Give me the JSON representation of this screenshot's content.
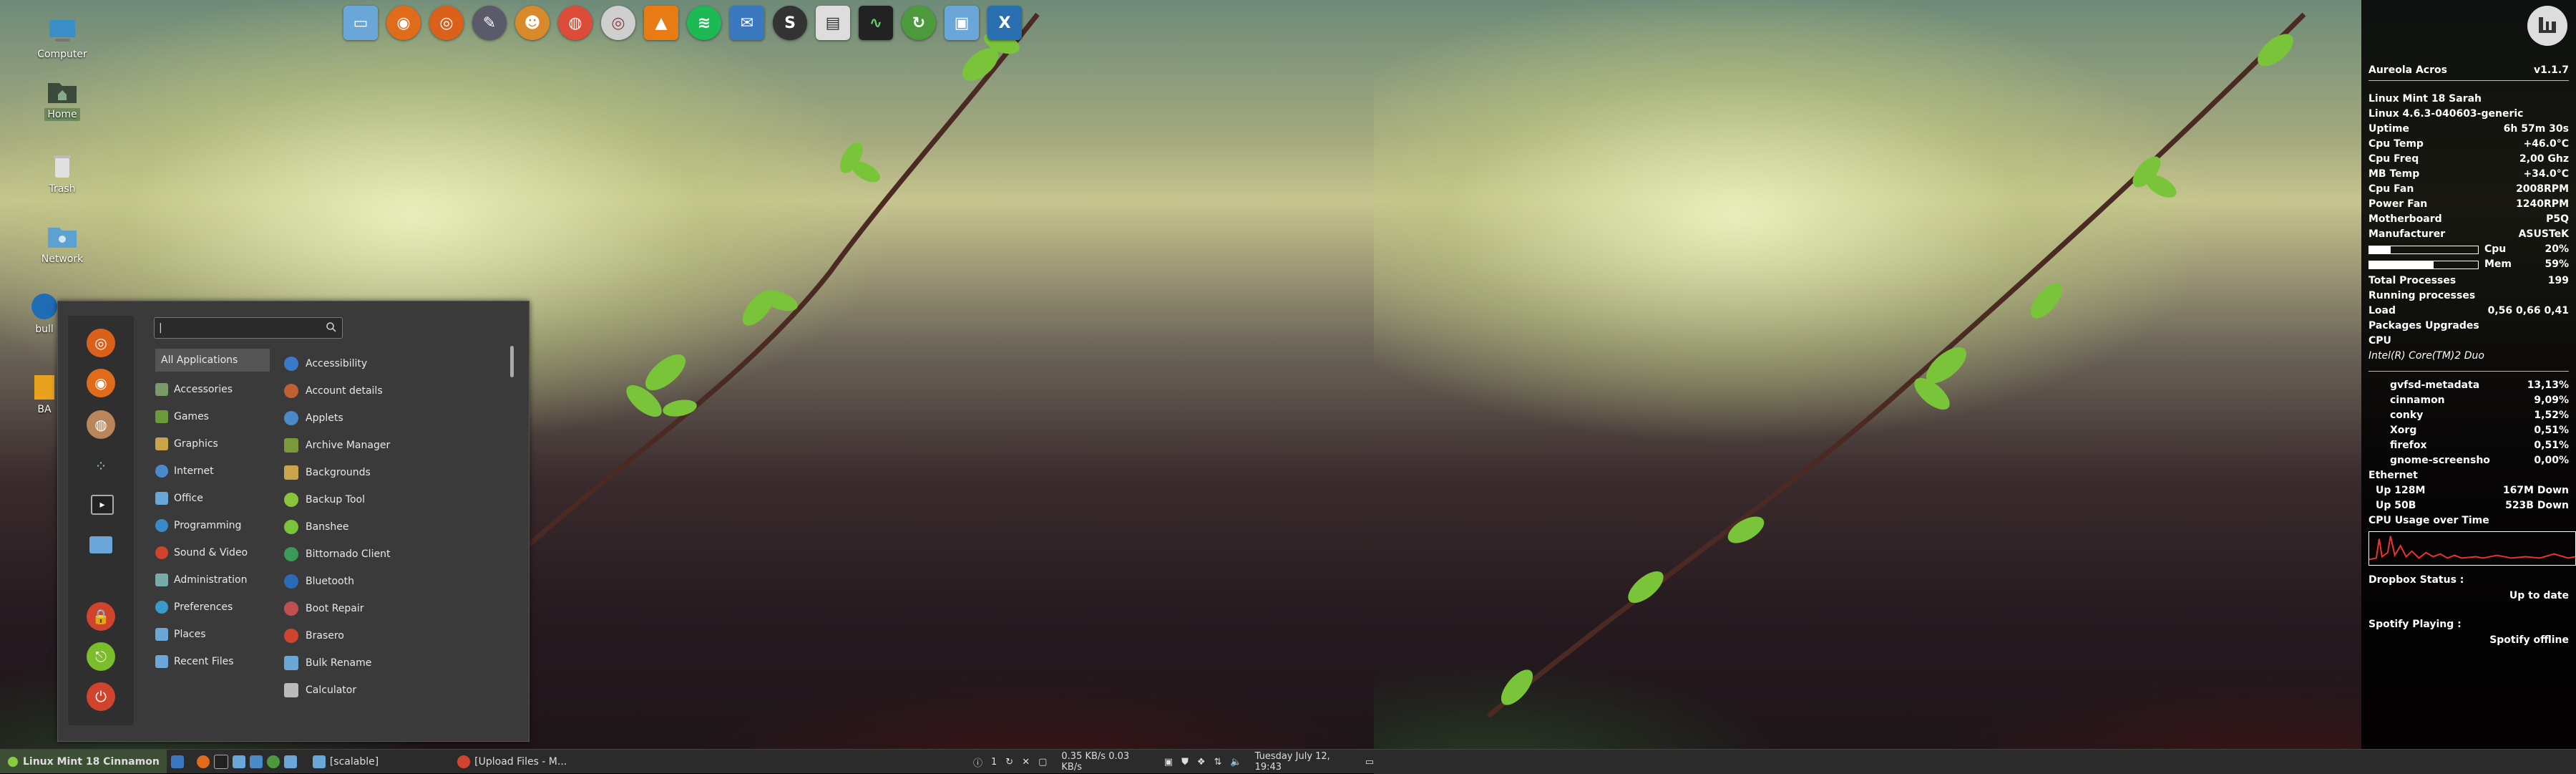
{
  "desktop_icons": [
    {
      "label": "Computer",
      "icon": "computer-icon"
    },
    {
      "label": "Home",
      "icon": "home-folder-icon",
      "selected": true
    },
    {
      "label": "Trash",
      "icon": "trash-icon"
    },
    {
      "label": "Network",
      "icon": "network-icon"
    },
    {
      "label": "bull",
      "icon": "app-icon"
    },
    {
      "label": "BA",
      "icon": "folder-icon"
    }
  ],
  "dock": [
    "files-icon",
    "firefox-icon",
    "browser-icon",
    "inkscape-icon",
    "gimp-icon",
    "chrome-icon",
    "disk-icon",
    "vlc-icon",
    "spotify-icon",
    "notes-icon",
    "sublime-icon",
    "archive-icon",
    "system-monitor-icon",
    "update-icon",
    "screenshot-icon",
    "x-icon"
  ],
  "menu": {
    "search_value": "|",
    "categories": [
      "All Applications",
      "Accessories",
      "Games",
      "Graphics",
      "Internet",
      "Office",
      "Programming",
      "Sound & Video",
      "Administration",
      "Preferences",
      "Places",
      "Recent Files"
    ],
    "apps": [
      "Accessibility",
      "Account details",
      "Applets",
      "Archive Manager",
      "Backgrounds",
      "Backup Tool",
      "Banshee",
      "Bittornado Client",
      "Bluetooth",
      "Boot Repair",
      "Brasero",
      "Bulk Rename",
      "Calculator"
    ],
    "favorites": [
      "browser-icon",
      "firefox-icon",
      "disk-icon",
      "connect-icon",
      "terminal-icon",
      "folder-icon",
      "lock-icon",
      "logout-icon",
      "power-icon"
    ]
  },
  "panel": {
    "menu_label": "Linux Mint 18 Cinnamon",
    "tasks": [
      "[scalable]",
      "[Upload Files - M..."
    ],
    "workspace": "1",
    "net_speed": "0.35 KB/s  0.03 KB/s",
    "clock": "Tuesday July 12, 19:43"
  },
  "conky": {
    "title": "Aureola Acros",
    "version": "v1.1.7",
    "os": "Linux Mint 18 Sarah",
    "kernel": "Linux 4.6.3-040603-generic",
    "stats": [
      {
        "label": "Uptime",
        "value": "6h 57m 30s"
      },
      {
        "label": "Cpu Temp",
        "value": "+46.0°C"
      },
      {
        "label": "Cpu Freq",
        "value": "2,00 Ghz"
      },
      {
        "label": "MB Temp",
        "value": "+34.0°C"
      },
      {
        "label": "Cpu Fan",
        "value": "2008RPM"
      },
      {
        "label": "Power Fan",
        "value": "1240RPM"
      },
      {
        "label": "Motherboard",
        "value": "P5Q"
      },
      {
        "label": "Manufacturer",
        "value": "ASUSTeK"
      }
    ],
    "cpu": {
      "label": "Cpu",
      "value": "20%",
      "fraction": 0.2
    },
    "mem": {
      "label": "Mem",
      "value": "59%",
      "fraction": 0.59
    },
    "total_processes": {
      "label": "Total Processes",
      "value": "199"
    },
    "running_processes": {
      "label": "Running processes",
      "value": ""
    },
    "load": {
      "label": "Load",
      "value": "0,56 0,66 0,41"
    },
    "packages": {
      "label": "Packages Upgrades",
      "value": ""
    },
    "cpu_header": "CPU",
    "cpu_model": "Intel(R) Core(TM)2 Duo",
    "processes": [
      {
        "name": "gvfsd-metadata",
        "value": "13,13%"
      },
      {
        "name": "cinnamon",
        "value": "9,09%"
      },
      {
        "name": "conky",
        "value": "1,52%"
      },
      {
        "name": "Xorg",
        "value": "0,51%"
      },
      {
        "name": "firefox",
        "value": "0,51%"
      },
      {
        "name": "gnome-screensho",
        "value": "0,00%"
      }
    ],
    "ethernet": {
      "label": "Ethernet",
      "rows": [
        {
          "left": "Up 128M",
          "right": "167M Down"
        },
        {
          "left": "Up 50B",
          "right": "523B Down"
        }
      ]
    },
    "cpu_usage_label": "CPU Usage over Time",
    "dropbox_label": "Dropbox Status :",
    "dropbox_value": "Up to date",
    "spotify_label": "Spotify Playing :",
    "spotify_value": "Spotify offline"
  }
}
